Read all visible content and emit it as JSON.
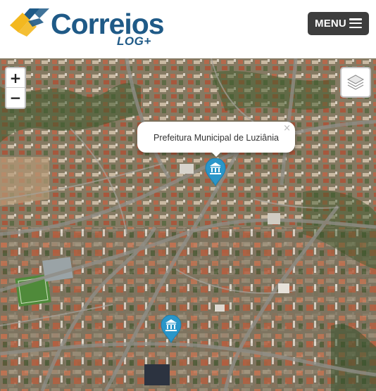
{
  "header": {
    "logo_text": "Correios",
    "logo_sub": "LOG+",
    "menu_label": "MENU",
    "colors": {
      "brand_blue": "#1f5a87",
      "brand_yellow": "#f3b81f",
      "menu_bg": "#3d3d3d"
    }
  },
  "map": {
    "zoom_in": "+",
    "zoom_out": "−",
    "layers_icon": "layers-icon",
    "marker_color": "#2a96c9",
    "popup": {
      "text": "Prefeitura Municipal de Luziânia",
      "close": "×"
    },
    "markers": [
      {
        "name": "prefeitura-marker",
        "icon": "government-building-icon"
      },
      {
        "name": "agency-marker",
        "icon": "government-building-icon"
      }
    ]
  }
}
